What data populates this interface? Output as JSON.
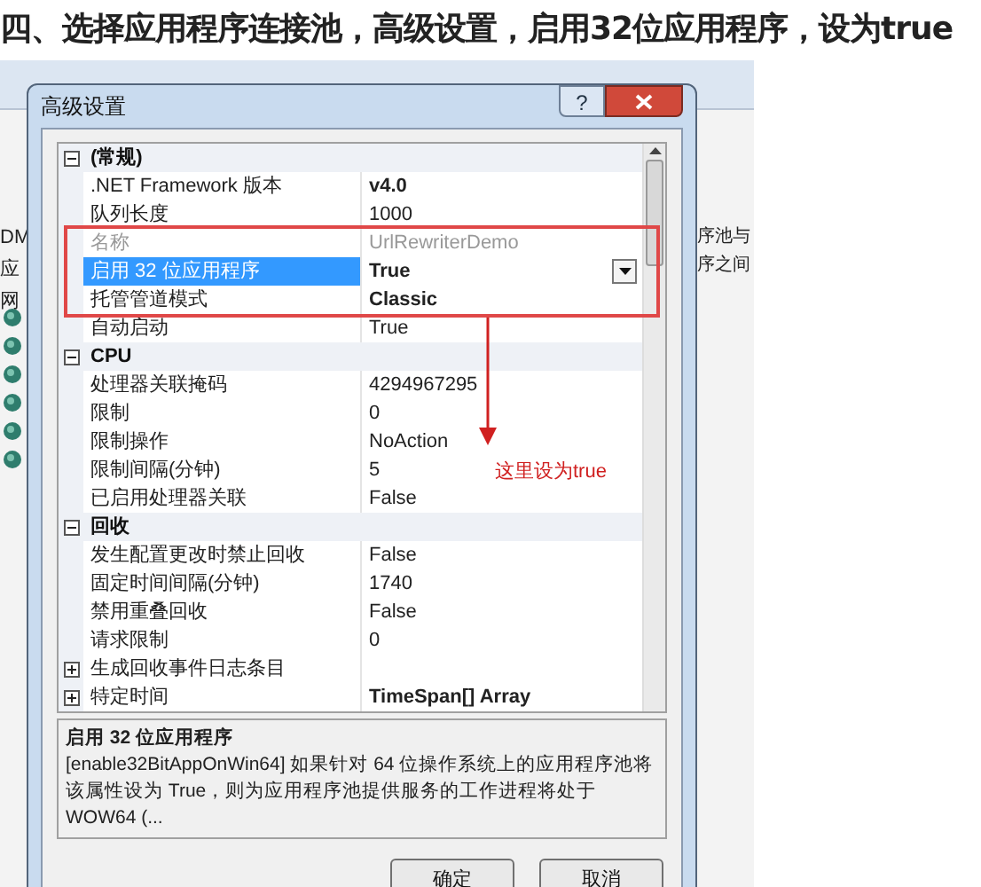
{
  "heading": "四、选择应用程序连接池，高级设置，启用32位应用程序，设为true",
  "background_window": {
    "left_texts": [
      "DM",
      "应",
      "网"
    ],
    "right_texts": [
      "序池与",
      "序之间"
    ]
  },
  "dialog": {
    "title": "高级设置",
    "help_button": "?",
    "categories": [
      {
        "name": "(常规)",
        "expanded": true,
        "properties": [
          {
            "kind": "value",
            "label": ".NET Framework 版本",
            "value": "v4.0",
            "modified": true,
            "disabled": false,
            "selected": false
          },
          {
            "kind": "value",
            "label": "队列长度",
            "value": "1000",
            "modified": false,
            "disabled": false,
            "selected": false
          },
          {
            "kind": "value",
            "label": "名称",
            "value": "UrlRewriterDemo",
            "modified": false,
            "disabled": true,
            "selected": false
          },
          {
            "kind": "value",
            "label": "启用 32 位应用程序",
            "value": "True",
            "modified": true,
            "disabled": false,
            "selected": true,
            "dropdown": true
          },
          {
            "kind": "value",
            "label": "托管管道模式",
            "value": "Classic",
            "modified": true,
            "disabled": false,
            "selected": false
          },
          {
            "kind": "value",
            "label": "自动启动",
            "value": "True",
            "modified": false,
            "disabled": false,
            "selected": false
          }
        ]
      },
      {
        "name": "CPU",
        "expanded": true,
        "properties": [
          {
            "kind": "value",
            "label": "处理器关联掩码",
            "value": "4294967295",
            "modified": false,
            "disabled": false,
            "selected": false
          },
          {
            "kind": "value",
            "label": "限制",
            "value": "0",
            "modified": false,
            "disabled": false,
            "selected": false
          },
          {
            "kind": "value",
            "label": "限制操作",
            "value": "NoAction",
            "modified": false,
            "disabled": false,
            "selected": false
          },
          {
            "kind": "value",
            "label": "限制间隔(分钟)",
            "value": "5",
            "modified": false,
            "disabled": false,
            "selected": false
          },
          {
            "kind": "value",
            "label": "已启用处理器关联",
            "value": "False",
            "modified": false,
            "disabled": false,
            "selected": false
          }
        ]
      },
      {
        "name": "回收",
        "expanded": true,
        "properties": [
          {
            "kind": "value",
            "label": "发生配置更改时禁止回收",
            "value": "False",
            "modified": false,
            "disabled": false,
            "selected": false
          },
          {
            "kind": "value",
            "label": "固定时间间隔(分钟)",
            "value": "1740",
            "modified": false,
            "disabled": false,
            "selected": false
          },
          {
            "kind": "value",
            "label": "禁用重叠回收",
            "value": "False",
            "modified": false,
            "disabled": false,
            "selected": false
          },
          {
            "kind": "value",
            "label": "请求限制",
            "value": "0",
            "modified": false,
            "disabled": false,
            "selected": false
          },
          {
            "kind": "group",
            "label": "生成回收事件日志条目",
            "expanded": false
          },
          {
            "kind": "group",
            "label": "特定时间",
            "value": "TimeSpan[] Array",
            "modified": true,
            "expanded": false
          }
        ]
      }
    ],
    "description": {
      "title": "启用 32 位应用程序",
      "text": "[enable32BitAppOnWin64] 如果针对 64 位操作系统上的应用程序池将该属性设为 True，则为应用程序池提供服务的工作进程将处于 WOW64 (..."
    },
    "buttons": [
      "确定",
      "取消"
    ]
  },
  "annotation": {
    "text": "这里设为true"
  }
}
